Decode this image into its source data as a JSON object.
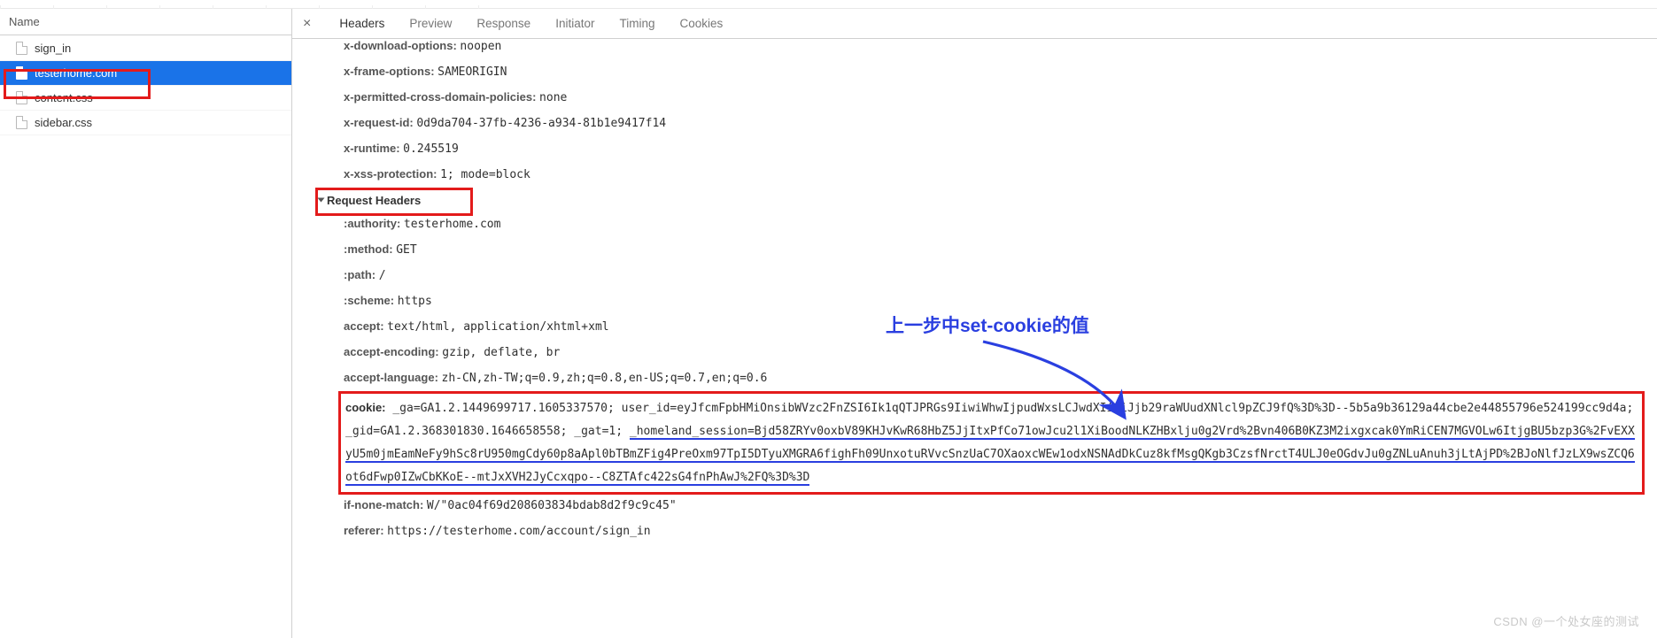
{
  "sidebar": {
    "header": "Name",
    "items": [
      {
        "label": "sign_in"
      },
      {
        "label": "testerhome.com"
      },
      {
        "label": "content.css"
      },
      {
        "label": "sidebar.css"
      }
    ]
  },
  "tabs": {
    "headers": "Headers",
    "preview": "Preview",
    "response": "Response",
    "initiator": "Initiator",
    "timing": "Timing",
    "cookies": "Cookies"
  },
  "response_headers_tail": [
    {
      "k": "x-download-options:",
      "v": "noopen"
    },
    {
      "k": "x-frame-options:",
      "v": "SAMEORIGIN"
    },
    {
      "k": "x-permitted-cross-domain-policies:",
      "v": "none"
    },
    {
      "k": "x-request-id:",
      "v": "0d9da704-37fb-4236-a934-81b1e9417f14"
    },
    {
      "k": "x-runtime:",
      "v": "0.245519"
    },
    {
      "k": "x-xss-protection:",
      "v": "1; mode=block"
    }
  ],
  "section_request_headers": "Request Headers",
  "request_headers_top": [
    {
      "k": ":authority:",
      "v": "testerhome.com"
    },
    {
      "k": ":method:",
      "v": "GET"
    },
    {
      "k": ":path:",
      "v": "/"
    },
    {
      "k": ":scheme:",
      "v": "https"
    },
    {
      "k": "accept:",
      "v": "text/html, application/xhtml+xml"
    },
    {
      "k": "accept-encoding:",
      "v": "gzip, deflate, br"
    },
    {
      "k": "accept-language:",
      "v": "zh-CN,zh-TW;q=0.9,zh;q=0.8,en-US;q=0.7,en;q=0.6"
    }
  ],
  "cookie": {
    "label": "cookie:",
    "prefix": "_ga=GA1.2.1449699717.1605337570; user_id=eyJfcmFpbHMiOnsibWVzc2FnZSI6Ik1qQTJPRGs9IiwiWhwIjpudWxsLCJwdXIiOiJjb29raWUudXNlcl9pZCJ9fQ%3D%3D--5b5a9b36129a44cbe2e44855796e524199cc9d4a; _gid=GA1.2.368301830.1646658558; _gat=1; ",
    "session": "_homeland_session=Bjd58ZRYv0oxbV89KHJvKwR68HbZ5JjItxPfCo71owJcu2l1XiBoodNLKZHBxlju0g2Vrd%2Bvn406B0KZ3M2ixgxcak0YmRiCEN7MGVOLw6ItjgBU5bzp3G%2FvEXXyU5m0jmEamNeFy9hSc8rU950mgCdy60p8aApl0bTBmZFig4PreOxm97TpI5DTyuXMGRA6fighFh09UnxotuRVvcSnzUaC7OXaoxcWEw1odxNSNAdDkCuz8kfMsgQKgb3CzsfNrctT4ULJ0eOGdvJu0gZNLuAnuh3jLtAjPD%2BJoNlfJzLX9wsZCQ6ot6dFwp0IZwCbKKoE--mtJxXVH2JyCcxqpo--C8ZTAfc422sG4fnPhAwJ%2FQ%3D%3D"
  },
  "request_headers_bottom": [
    {
      "k": "if-none-match:",
      "v": "W/\"0ac04f69d208603834bdab8d2f9c9c45\""
    },
    {
      "k": "referer:",
      "v": "https://testerhome.com/account/sign_in"
    }
  ],
  "annotation": "上一步中set-cookie的值",
  "watermark": "CSDN @一个处女座的测试"
}
